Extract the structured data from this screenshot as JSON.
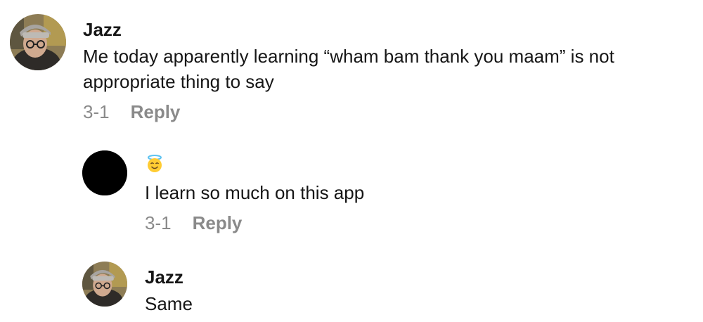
{
  "comments": [
    {
      "username": "Jazz",
      "text": "Me today apparently learning “wham bam thank you maam” is not appropriate thing to say",
      "date": "3-1",
      "reply_label": "Reply",
      "avatar_icon": "user-photo-avatar"
    },
    {
      "username": "",
      "emoji": "😇",
      "text": "I learn so much on this app",
      "date": "3-1",
      "reply_label": "Reply",
      "avatar_icon": "black-circle-avatar"
    },
    {
      "username": "Jazz",
      "text": "Same",
      "avatar_icon": "user-photo-avatar"
    }
  ],
  "colors": {
    "text": "#161616",
    "meta": "#8a8a8a",
    "background": "#ffffff"
  }
}
